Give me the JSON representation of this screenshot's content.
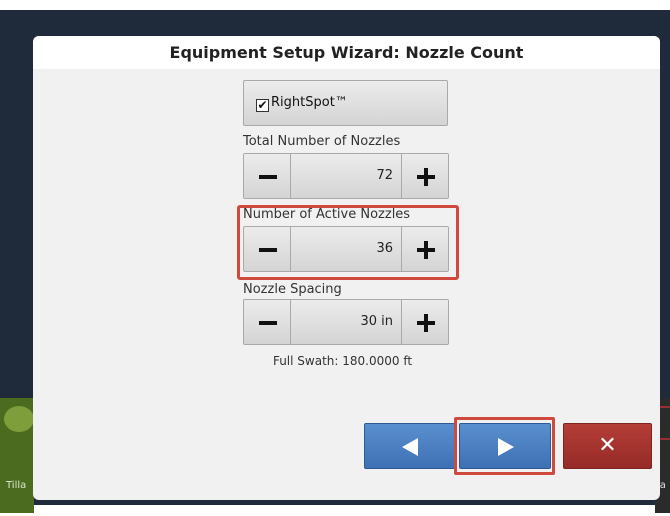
{
  "dialog": {
    "title": "Equipment Setup Wizard:  Nozzle Count",
    "rightspot_label": "RightSpot™",
    "rightspot_checked": true,
    "check_glyph": "✔",
    "fields": [
      {
        "label": "Total Number of Nozzles",
        "value": "72"
      },
      {
        "label": "Number of Active Nozzles",
        "value": "36"
      },
      {
        "label": "Nozzle Spacing",
        "value": "30 in"
      }
    ],
    "full_swath": "Full Swath:  180.0000 ft",
    "buttons": {
      "back": "back-arrow-icon",
      "next": "next-arrow-icon",
      "close": "✕"
    },
    "accent_colors": {
      "nav_blue": "#4a7fc1",
      "close_red": "#a3332e",
      "highlight": "#cf4a3c"
    }
  },
  "background": {
    "left_label": "Tilla",
    "right_label": "ia"
  }
}
